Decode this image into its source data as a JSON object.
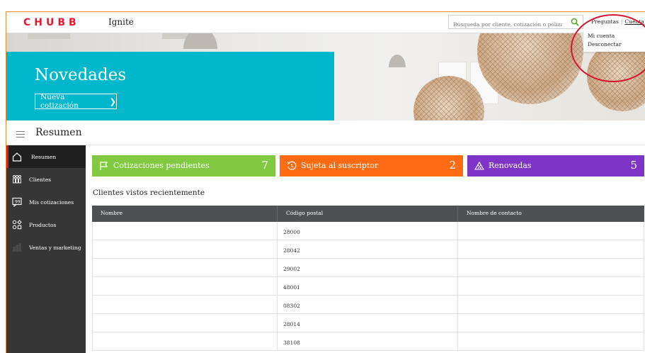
{
  "header": {
    "brand": "CHUBB",
    "app_title": "Ignite",
    "search_placeholder": "Búsqueda por cliente, cotización o póliza",
    "questions_link": "Preguntas",
    "separator": "|",
    "account_link": "Cuenta"
  },
  "account_menu": {
    "items": [
      "Mi cuenta",
      "Desconectar"
    ]
  },
  "hero": {
    "title": "Novedades",
    "button_label": "Nueva cotización",
    "accent_color": "#00b7cc"
  },
  "page": {
    "title": "Resumen"
  },
  "sidebar": {
    "items": [
      {
        "label": "Resumen",
        "icon": "home-icon",
        "active": true
      },
      {
        "label": "Clientes",
        "icon": "clients-icon",
        "active": false
      },
      {
        "label": "Mis cotizaciones",
        "icon": "quotes-icon",
        "active": false
      },
      {
        "label": "Productos",
        "icon": "products-icon",
        "active": false
      },
      {
        "label": "Ventas y marketing",
        "icon": "marketing-icon",
        "active": false
      }
    ]
  },
  "cards": [
    {
      "label": "Cotizaciones pendientes",
      "count": "7",
      "color": "#80c940",
      "icon": "flag-icon"
    },
    {
      "label": "Sujeta al suscriptor",
      "count": "2",
      "color": "#ff6b12",
      "icon": "clock-icon"
    },
    {
      "label": "Renovadas",
      "count": "5",
      "color": "#7e34c7",
      "icon": "percent-icon"
    }
  ],
  "recent_clients": {
    "title": "Clientes vistos recientemente",
    "columns": [
      "Nombre",
      "Código postal",
      "Nombre de contacto"
    ],
    "rows": [
      {
        "name": "",
        "postal_code": "28000",
        "contact": ""
      },
      {
        "name": "",
        "postal_code": "28042",
        "contact": ""
      },
      {
        "name": "",
        "postal_code": "29002",
        "contact": ""
      },
      {
        "name": "",
        "postal_code": "48001",
        "contact": ""
      },
      {
        "name": "",
        "postal_code": "08302",
        "contact": ""
      },
      {
        "name": "",
        "postal_code": "28014",
        "contact": ""
      },
      {
        "name": "",
        "postal_code": "38108",
        "contact": ""
      }
    ]
  },
  "colors": {
    "brand_red": "#e21932",
    "sidebar_bg": "#363636",
    "table_header": "#4f5054",
    "highlight_circle": "#d6162f"
  }
}
